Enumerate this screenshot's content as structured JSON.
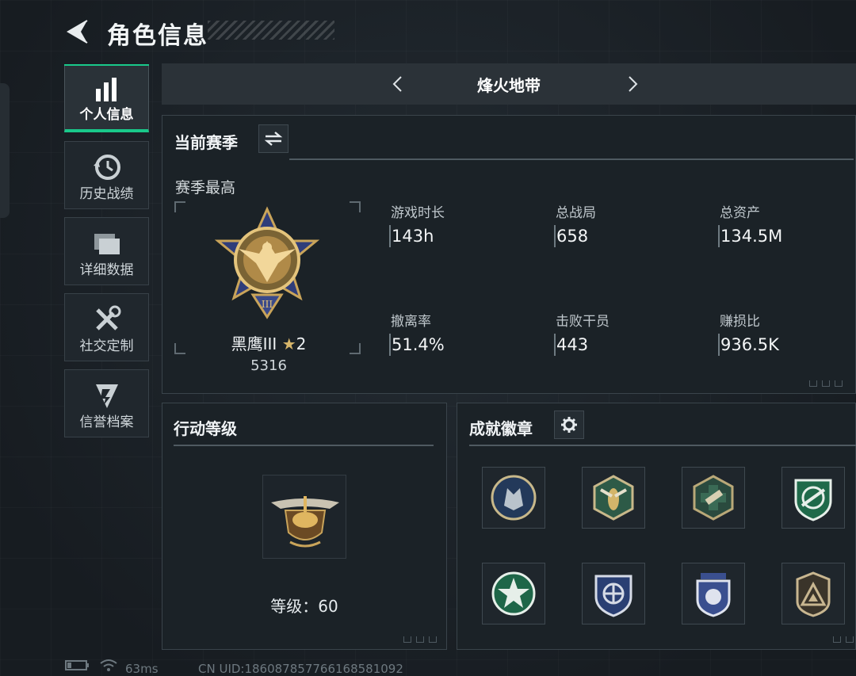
{
  "header": {
    "title": "角色信息"
  },
  "sidebar": {
    "items": [
      {
        "label": "个人信息",
        "icon": "bar-chart-icon",
        "active": true
      },
      {
        "label": "历史战绩",
        "icon": "history-icon",
        "active": false
      },
      {
        "label": "详细数据",
        "icon": "folder-icon",
        "active": false
      },
      {
        "label": "社交定制",
        "icon": "tools-icon",
        "active": false
      },
      {
        "label": "信誉档案",
        "icon": "credit-shield-icon",
        "active": false
      }
    ]
  },
  "mode_selector": {
    "current": "烽火地带"
  },
  "season_panel": {
    "title": "当前赛季",
    "subtitle": "赛季最高",
    "rank_name": "黑鹰III",
    "rank_stars": "2",
    "rank_score": "5316",
    "stats": [
      {
        "label": "游戏时长",
        "value": "143h"
      },
      {
        "label": "总战局",
        "value": "658"
      },
      {
        "label": "总资产",
        "value": "134.5M"
      },
      {
        "label": "撤离率",
        "value": "51.4%"
      },
      {
        "label": "击败干员",
        "value": "443"
      },
      {
        "label": "赚损比",
        "value": "936.5K"
      }
    ]
  },
  "action_level_panel": {
    "title": "行动等级",
    "level_text": "等级：60"
  },
  "achievements_panel": {
    "title": "成就徽章",
    "badges": [
      "wolf-badge-icon",
      "wasp-badge-icon",
      "medic-badge-icon",
      "crosshair-rifle-badge-icon",
      "star-badge-icon",
      "shield-crosshair-badge-icon",
      "police-badge-icon",
      "triangle-badge-icon"
    ]
  },
  "status_bar": {
    "ping": "63ms",
    "uid": "CN UID:18608785776616858109​2"
  },
  "colors": {
    "accent": "#19c98a",
    "panel": "#1b2227",
    "background": "#1a2026",
    "gold": "#c9a45a"
  }
}
